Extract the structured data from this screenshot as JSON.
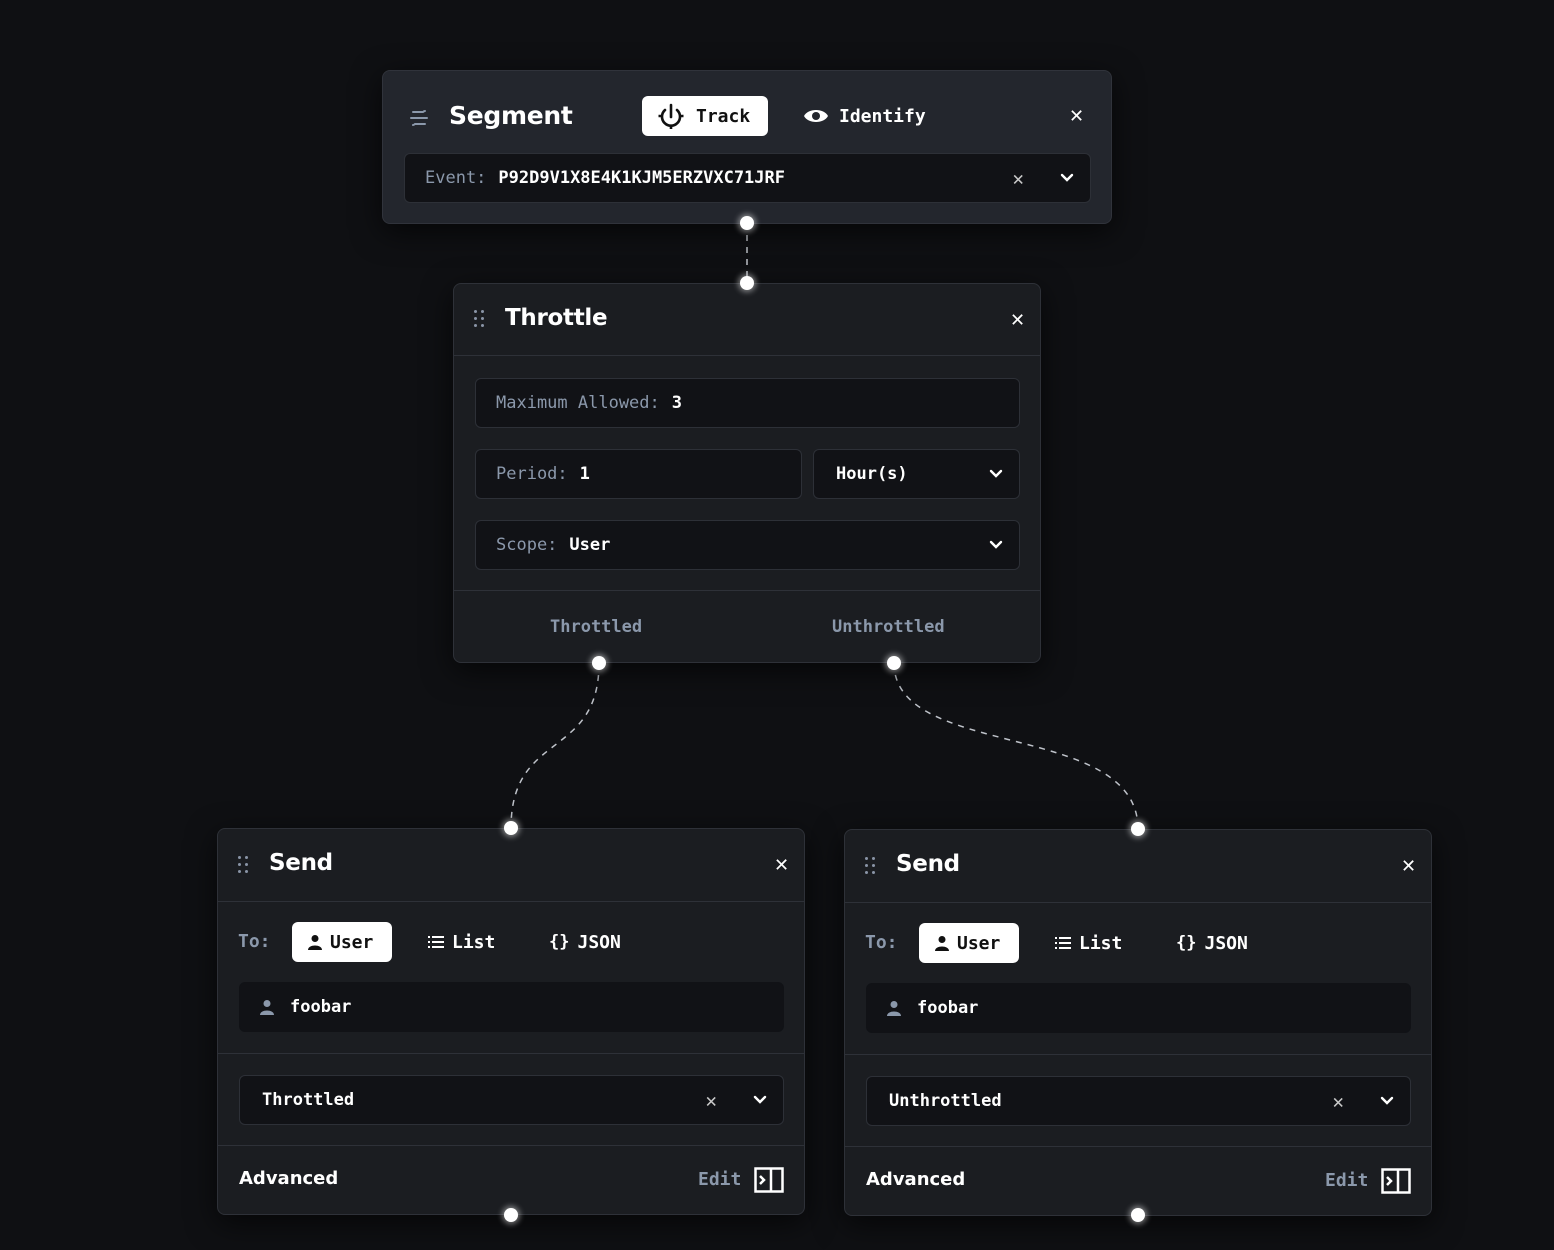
{
  "segment_node": {
    "title": "Segment",
    "icon": "segment-logo-icon",
    "modes": [
      {
        "label": "Track",
        "icon": "track-icon",
        "active": true
      },
      {
        "label": "Identify",
        "icon": "eye-icon",
        "active": false
      }
    ],
    "close_icon": "close-icon",
    "event_label": "Event:",
    "event_value": "P92D9V1X8E4K1KJM5ERZVXC71JRF",
    "clear_icon": "clear-icon",
    "dropdown_icon": "chevron-down-icon"
  },
  "throttle_node": {
    "title": "Throttle",
    "close_icon": "close-icon",
    "max_allowed_label": "Maximum Allowed:",
    "max_allowed_value": "3",
    "period_label": "Period:",
    "period_value": "1",
    "period_unit": "Hour(s)",
    "scope_label": "Scope:",
    "scope_value": "User",
    "outputs": [
      "Throttled",
      "Unthrottled"
    ]
  },
  "send_nodes": [
    {
      "title": "Send",
      "to_label": "To:",
      "to_options": [
        {
          "label": "User",
          "icon": "user-icon",
          "active": true
        },
        {
          "label": "List",
          "icon": "list-icon",
          "active": false
        },
        {
          "label": "JSON",
          "icon": "braces-icon",
          "active": false
        }
      ],
      "recipient": "foobar",
      "template_value": "Throttled",
      "advanced_label": "Advanced",
      "edit_label": "Edit"
    },
    {
      "title": "Send",
      "to_label": "To:",
      "to_options": [
        {
          "label": "User",
          "icon": "user-icon",
          "active": true
        },
        {
          "label": "List",
          "icon": "list-icon",
          "active": false
        },
        {
          "label": "JSON",
          "icon": "braces-icon",
          "active": false
        }
      ],
      "recipient": "foobar",
      "template_value": "Unthrottled",
      "advanced_label": "Advanced",
      "edit_label": "Edit"
    }
  ],
  "colors": {
    "background": "#0f1013",
    "panel": "#1b1d21",
    "segment_panel": "#23262d",
    "muted_text": "#8b98ab",
    "edge": "#bfc3ca"
  }
}
